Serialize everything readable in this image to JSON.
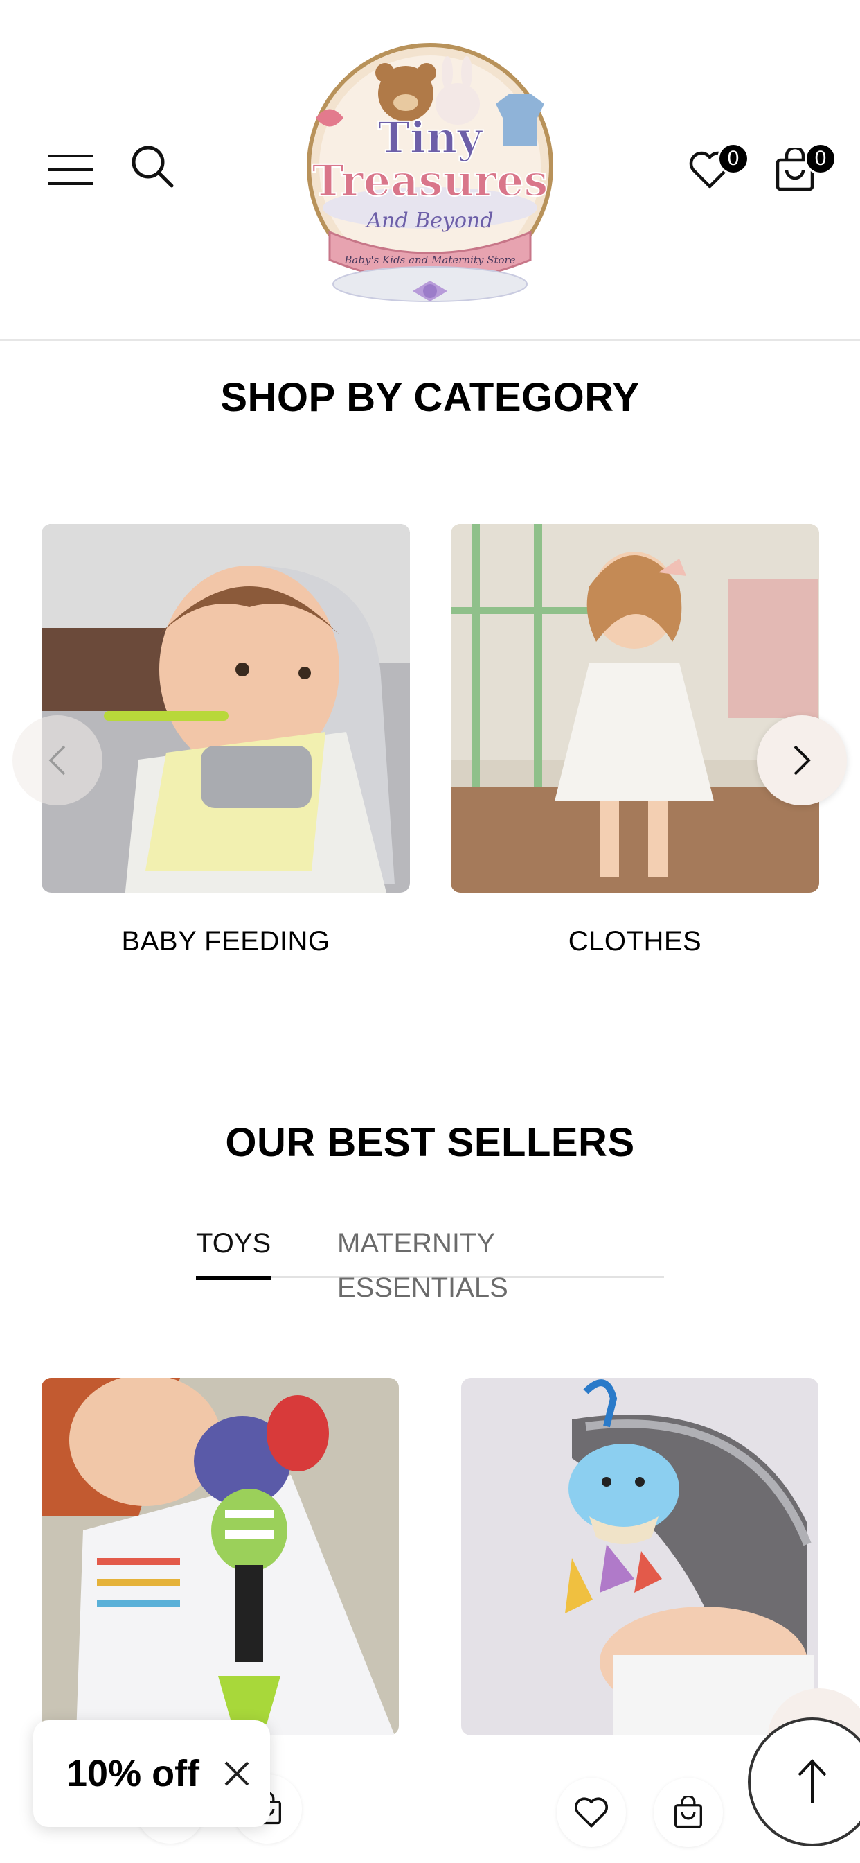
{
  "header": {
    "menu_icon": "hamburger-menu-icon",
    "search_icon": "search-icon",
    "wishlist_icon": "heart-icon",
    "wishlist_count": "0",
    "cart_icon": "shopping-bag-icon",
    "cart_count": "0",
    "logo": {
      "line1": "Tiny",
      "line2": "Treasures",
      "line3": "And Beyond",
      "tagline": "Baby's Kids and Maternity Store"
    }
  },
  "categories": {
    "title": "SHOP BY CATEGORY",
    "items": [
      {
        "label": "BABY FEEDING"
      },
      {
        "label": "CLOTHES"
      }
    ],
    "prev_icon": "chevron-left-icon",
    "next_icon": "chevron-right-icon"
  },
  "best_sellers": {
    "title": "OUR BEST SELLERS",
    "tabs": [
      {
        "label": "TOYS",
        "active": true
      },
      {
        "label": "MATERNITY ESSENTIALS",
        "active": false
      }
    ]
  },
  "discount_popup": {
    "text": "10% off",
    "close_icon": "close-icon"
  },
  "scroll_top_icon": "arrow-up-icon",
  "colors": {
    "text": "#000000",
    "muted": "#6b6b6b",
    "arrow_bg": "#f6efeb",
    "logo_pink": "#d9768a",
    "logo_purple": "#6d5fa8"
  }
}
